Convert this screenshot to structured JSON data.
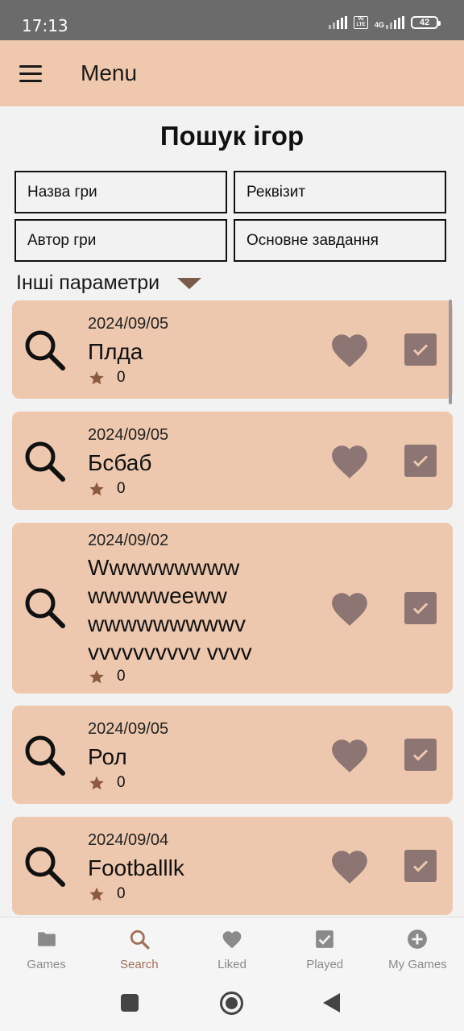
{
  "status_bar": {
    "time": "17:13",
    "volte": "Vo LTE",
    "network": "4G",
    "battery": "42"
  },
  "app_bar": {
    "title": "Menu"
  },
  "page": {
    "title": "Пошук ігор"
  },
  "filters": {
    "game_name": "Назва гри",
    "props": "Реквізит",
    "game_author": "Автор гри",
    "main_task": "Основне завдання"
  },
  "more_params": {
    "label": "Інші параметри"
  },
  "games": [
    {
      "date": "2024/09/05",
      "name": "Плда",
      "rating": "0"
    },
    {
      "date": "2024/09/05",
      "name": "Бсбаб",
      "rating": "0"
    },
    {
      "date": "2024/09/02",
      "name": "Wwwwwwwww wwwwweeww wwwwwwwwwv vvvvvvvvvv vvvv",
      "rating": "0"
    },
    {
      "date": "2024/09/05",
      "name": "Рол",
      "rating": "0"
    },
    {
      "date": "2024/09/04",
      "name": "Footballlk",
      "rating": "0"
    }
  ],
  "bottom_nav": [
    {
      "label": "Games",
      "icon": "folder-icon"
    },
    {
      "label": "Search",
      "icon": "search-icon",
      "active": true
    },
    {
      "label": "Liked",
      "icon": "heart-icon"
    },
    {
      "label": "Played",
      "icon": "checkbox-icon"
    },
    {
      "label": "My Games",
      "icon": "add-circle-icon"
    }
  ],
  "colors": {
    "app_bar": "#efc8ad",
    "card": "#eec8ae",
    "heart": "#8d7574",
    "star": "#8d5a40",
    "active_nav": "#a0705a"
  }
}
